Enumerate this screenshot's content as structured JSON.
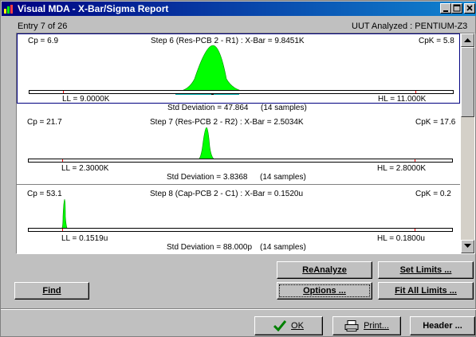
{
  "window": {
    "title": "Visual MDA - X-Bar/Sigma Report"
  },
  "header": {
    "entry": "Entry 7 of 26",
    "uut": "UUT Analyzed : PENTIUM-Z3"
  },
  "entries": [
    {
      "cp": "Cp = 6.9",
      "step": "Step 6 (Res-PCB 2 - R1) : X-Bar = 9.8451K",
      "cpk": "CpK = 5.8",
      "ll": "LL = 9.0000K",
      "hl": "HL = 11.000K",
      "std": "Std Deviation = 47.864",
      "samples": "(14 samples)"
    },
    {
      "cp": "Cp = 21.7",
      "step": "Step 7 (Res-PCB 2 - R2) : X-Bar = 2.5034K",
      "cpk": "CpK = 17.6",
      "ll": "LL = 2.3000K",
      "hl": "HL = 2.8000K",
      "std": "Std Deviation = 3.8368",
      "samples": "(14 samples)"
    },
    {
      "cp": "Cp = 53.1",
      "step": "Step 8 (Cap-PCB 2 - C1) : X-Bar = 0.1520u",
      "cpk": "CpK =  0.2",
      "ll": "LL = 0.1519u",
      "hl": "HL = 0.1800u",
      "std": "Std Deviation = 88.000p",
      "samples": "(14 samples)"
    }
  ],
  "buttons": {
    "reanalyze": "ReAnalyze",
    "set_limits": "Set Limits ...",
    "find": "Find",
    "options": "Options ...",
    "fit_all": "Fit All Limits ...",
    "ok": "OK",
    "print": "Print...",
    "header": "Header ..."
  },
  "colors": {
    "distribution": "#00ff00",
    "sigma_band": "#00b0b0",
    "limit_tick": "#ff0000"
  },
  "icons": {
    "app": "chart-icon",
    "ok": "checkmark-icon",
    "print": "printer-icon"
  }
}
